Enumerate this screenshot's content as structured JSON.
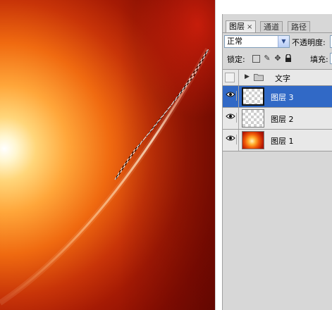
{
  "panel": {
    "tabs": [
      {
        "label": "图层",
        "close": "×",
        "active": true
      },
      {
        "label": "通道",
        "active": false
      },
      {
        "label": "路径",
        "active": false
      }
    ],
    "blend_mode": "正常",
    "opacity_label": "不透明度:",
    "lock_label": "锁定:",
    "fill_label": "填充:",
    "layers": [
      {
        "name": "文字",
        "type": "group",
        "visible": false,
        "selected": false
      },
      {
        "name": "图层 3",
        "type": "layer",
        "visible": true,
        "selected": true,
        "thumbnail": "transparent"
      },
      {
        "name": "图层 2",
        "type": "layer",
        "visible": true,
        "selected": false,
        "thumbnail": "transparent"
      },
      {
        "name": "图层 1",
        "type": "layer",
        "visible": true,
        "selected": false,
        "thumbnail": "fire-gradient"
      }
    ]
  },
  "icons": {
    "close": "close-icon",
    "dropdown": "chevron-down-icon",
    "lock_transparent": "lock-transparent-pixels-icon",
    "lock_image": "brush-icon",
    "lock_position": "move-icon",
    "lock_all": "lock-icon",
    "visibility": "eye-icon",
    "expand": "triangle-right-icon",
    "group": "folder-icon"
  },
  "colors": {
    "selection": "#3169c6",
    "panel_bg": "#d7d7d7",
    "row_bg": "#e8e8e8"
  }
}
